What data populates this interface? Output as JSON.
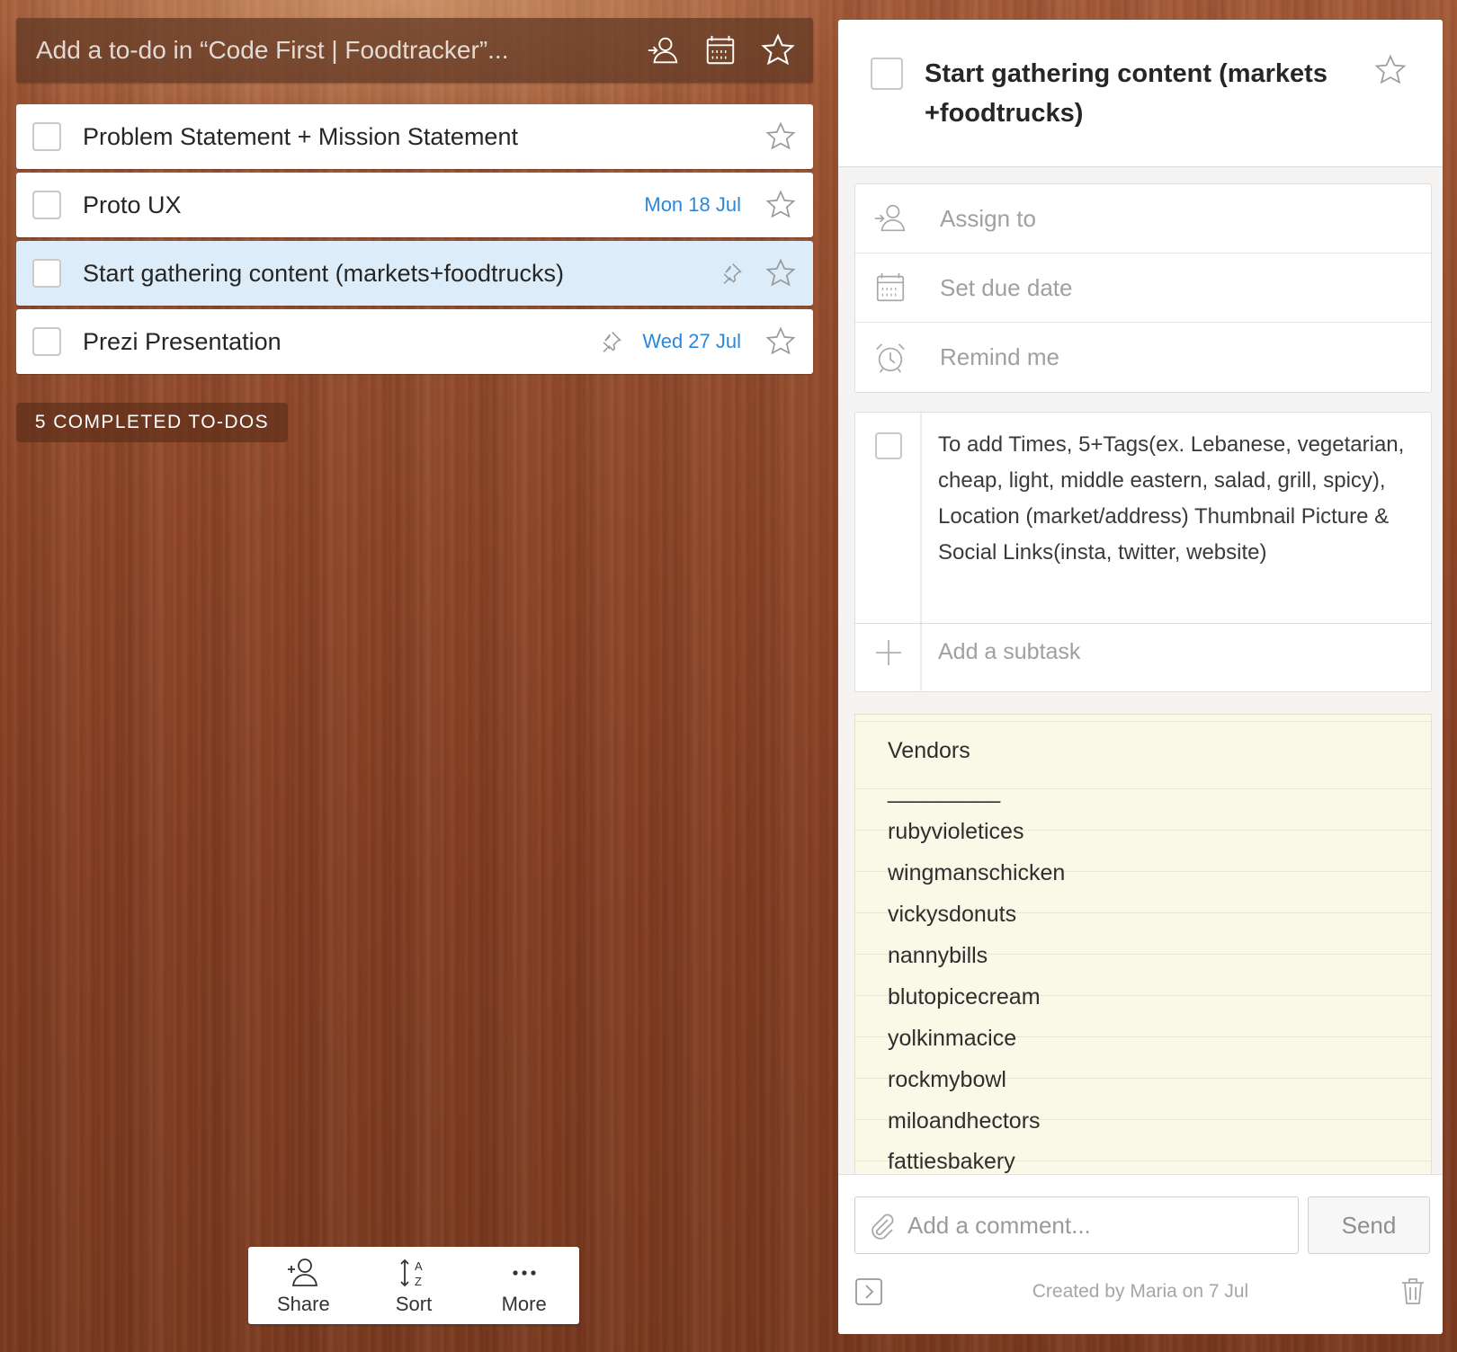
{
  "add_bar": {
    "placeholder": "Add a to-do in “Code First | Foodtracker”...",
    "icons": [
      "assign-icon",
      "calendar-icon",
      "star-icon"
    ]
  },
  "tasks": [
    {
      "title": "Problem Statement + Mission Statement",
      "due": "",
      "pinned": false,
      "selected": false
    },
    {
      "title": "Proto UX",
      "due": "Mon 18 Jul",
      "pinned": false,
      "selected": false
    },
    {
      "title": "Start gathering content (markets+foodtrucks)",
      "due": "",
      "pinned": true,
      "selected": true
    },
    {
      "title": "Prezi Presentation",
      "due": "Wed 27 Jul",
      "pinned": true,
      "selected": false
    }
  ],
  "completed_label": "5 COMPLETED TO-DOS",
  "toolbar": {
    "share": "Share",
    "sort": "Sort",
    "more": "More"
  },
  "detail": {
    "title": "Start gathering content (markets +foodtrucks)",
    "assign_label": "Assign to",
    "due_label": "Set due date",
    "remind_label": "Remind me",
    "subtask": "To add Times, 5+Tags(ex. Lebanese, vegetarian, cheap, light, middle eastern, salad, grill, spicy), Location (market/address) Thumbnail Picture & Social Links(insta, twitter, website)",
    "add_subtask": "Add a subtask",
    "note_lines": [
      "Vendors",
      "_________",
      "rubyvioletices",
      "wingmanschicken",
      "vickysdonuts",
      "nannybills",
      "blutopicecream",
      "yolkinmacice",
      "rockmybowl",
      "miloandhectors",
      "fattiesbakery"
    ],
    "comment_placeholder": "Add a comment...",
    "send_label": "Send",
    "created_text": "Created by Maria on 7 Jul"
  },
  "colors": {
    "accent_blue": "#2b88d9",
    "selected_bg": "#dcecf8",
    "note_bg": "#faf8e6"
  }
}
